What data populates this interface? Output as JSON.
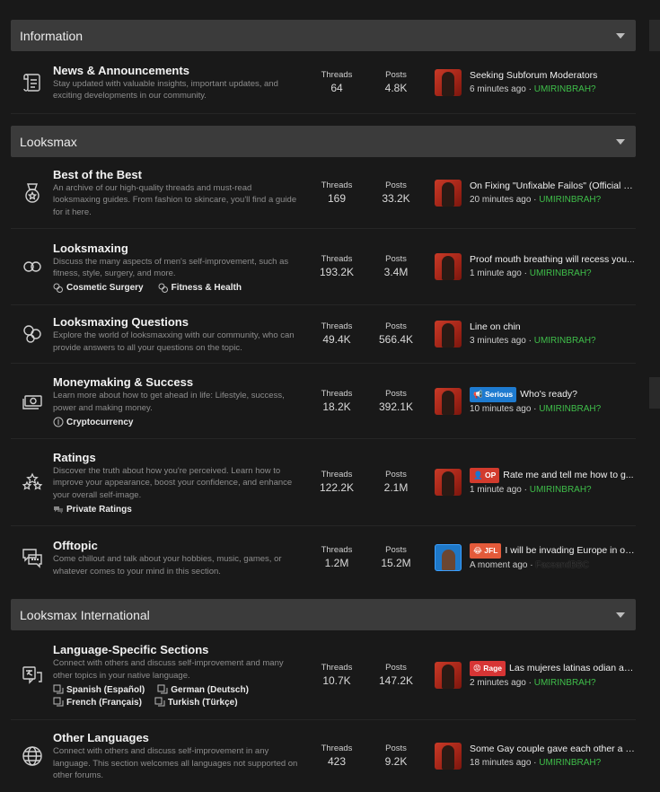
{
  "categories": [
    {
      "title": "Information",
      "forums": [
        {
          "title": "News & Announcements",
          "desc": [
            "Stay updated with valuable insights, important updates, and",
            "exciting developments in our community."
          ],
          "threads_label": "Threads",
          "threads": "64",
          "posts_label": "Posts",
          "posts": "4.8K",
          "lp_title": "Seeking Subforum Moderators",
          "lp_time": "6 minutes ago",
          "lp_user": "UMIRINBRAH?",
          "icon": "scroll-icon"
        }
      ]
    },
    {
      "title": "Looksmax",
      "forums": [
        {
          "title": "Best of the Best",
          "desc": [
            "An archive of our high-quality threads and must-read",
            "looksmaxing guides. From fashion to skincare, you'll find a guide",
            "for it here."
          ],
          "threads_label": "Threads",
          "threads": "169",
          "posts_label": "Posts",
          "posts": "33.2K",
          "lp_title": "On Fixing \"Unfixable Failos\" (Official G...",
          "lp_time": "20 minutes ago",
          "lp_user": "UMIRINBRAH?",
          "icon": "medal-icon"
        },
        {
          "title": "Looksmaxing",
          "desc": [
            "Discuss the many aspects of men's self-improvement, such as",
            "fitness, style, surgery, and more."
          ],
          "subforums": [
            "Cosmetic Surgery",
            "Fitness & Health"
          ],
          "threads_label": "Threads",
          "threads": "193.2K",
          "posts_label": "Posts",
          "posts": "3.4M",
          "lp_title": "Proof mouth breathing will recess you...",
          "lp_time": "1 minute ago",
          "lp_user": "UMIRINBRAH?",
          "icon": "infinity-icon"
        },
        {
          "title": "Looksmaxing Questions",
          "desc": [
            "Explore the world of looksmaxxing with our community, who can",
            "provide answers to all your questions on the topic."
          ],
          "threads_label": "Threads",
          "threads": "49.4K",
          "posts_label": "Posts",
          "posts": "566.4K",
          "lp_title": "Line on chin",
          "lp_time": "3 minutes ago",
          "lp_user": "UMIRINBRAH?",
          "icon": "circles-icon"
        },
        {
          "title": "Moneymaking & Success",
          "desc": [
            "Learn more about how to get ahead in life: Lifestyle, success,",
            "power and making money."
          ],
          "subforums": [
            "Cryptocurrency"
          ],
          "threads_label": "Threads",
          "threads": "18.2K",
          "posts_label": "Posts",
          "posts": "392.1K",
          "lp_prefix": "Serious",
          "lp_title": "Who's ready?",
          "lp_time": "10 minutes ago",
          "lp_user": "UMIRINBRAH?",
          "icon": "money-icon"
        },
        {
          "title": "Ratings",
          "desc": [
            "Discover the truth about how you're perceived. Learn how to",
            "improve your appearance, boost your confidence, and enhance",
            "your overall self-image."
          ],
          "subforums": [
            "Private Ratings"
          ],
          "threads_label": "Threads",
          "threads": "122.2K",
          "posts_label": "Posts",
          "posts": "2.1M",
          "lp_prefix": "OP",
          "lp_title": "Rate me and tell me how to g...",
          "lp_time": "1 minute ago",
          "lp_user": "UMIRINBRAH?",
          "icon": "stars-icon"
        },
        {
          "title": "Offtopic",
          "desc": [
            "Come chillout and talk about your hobbies, music, games, or",
            "whatever comes to your mind in this section."
          ],
          "threads_label": "Threads",
          "threads": "1.2M",
          "posts_label": "Posts",
          "posts": "15.2M",
          "lp_prefix": "JFL",
          "lp_title": "I will be invading Europe in on...",
          "lp_time": "A moment ago",
          "lp_user": "FaceandBBC",
          "lp_user_dark": true,
          "icon": "chat-icon"
        }
      ]
    },
    {
      "title": "Looksmax International",
      "forums": [
        {
          "title": "Language-Specific Sections",
          "desc": [
            "Connect with others and discuss self-improvement and many",
            "other topics in your native language."
          ],
          "subforums": [
            "Spanish (Español)",
            "German (Deutsch)",
            "French (Français)",
            "Turkish (Türkçe)"
          ],
          "threads_label": "Threads",
          "threads": "10.7K",
          "posts_label": "Posts",
          "posts": "147.2K",
          "lp_prefix": "Rage",
          "lp_title": "Las mujeres latinas odian a l...",
          "lp_time": "2 minutes ago",
          "lp_user": "UMIRINBRAH?",
          "icon": "translate-icon"
        },
        {
          "title": "Other Languages",
          "desc": [
            "Connect with others and discuss self-improvement in any",
            "language. This section welcomes all languages not supported on",
            "other forums."
          ],
          "threads_label": "Threads",
          "threads": "423",
          "posts_label": "Posts",
          "posts": "9.2K",
          "lp_title": "Some Gay couple gave each other a b...",
          "lp_time": "18 minutes ago",
          "lp_user": "UMIRINBRAH?",
          "icon": "globe-icon"
        }
      ]
    }
  ],
  "colors": {
    "background": "#191919",
    "header": "#3b3b3b",
    "username": "#3fbf4a"
  }
}
